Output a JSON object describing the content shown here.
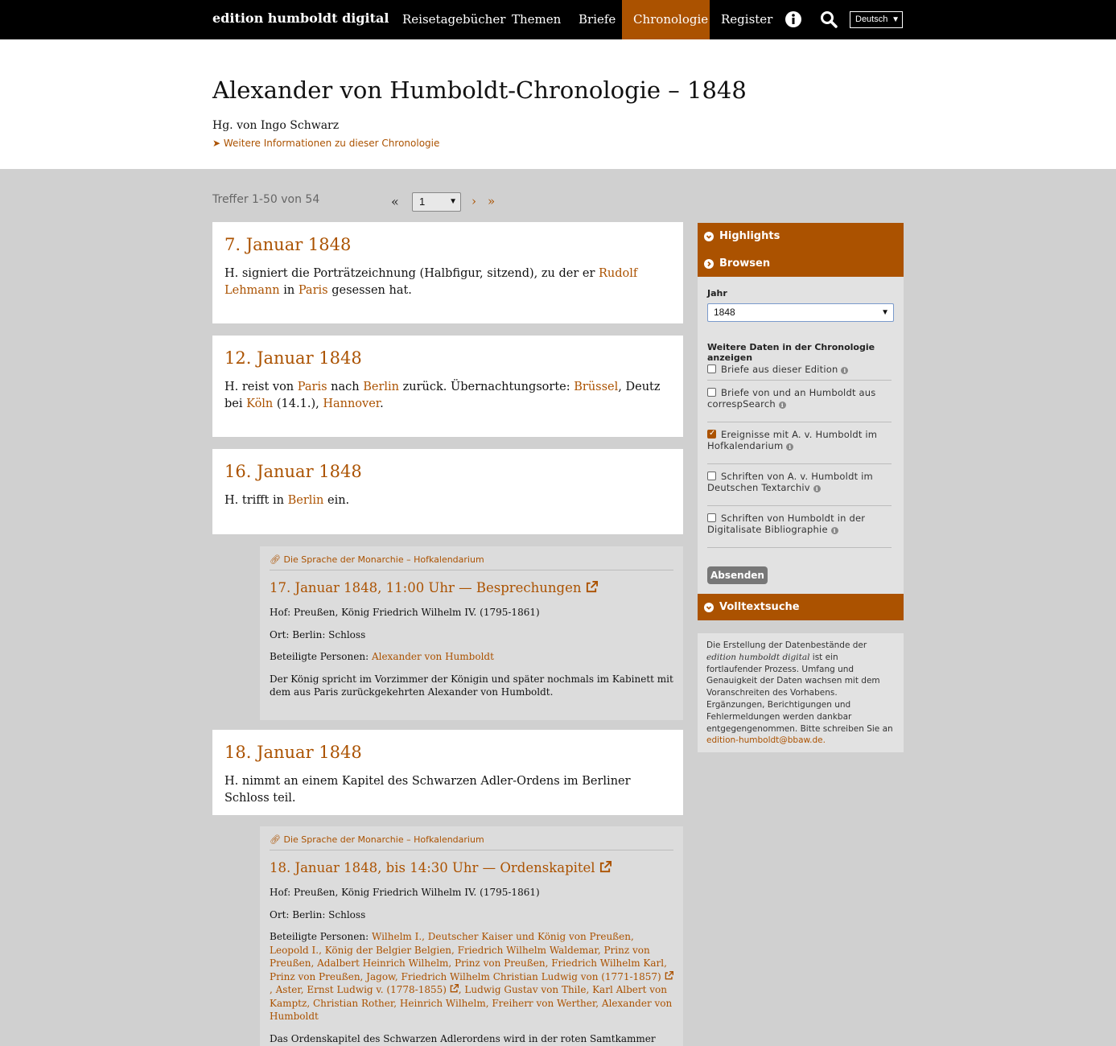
{
  "nav": {
    "brand": "edition humboldt digital",
    "items": [
      "Reisetagebücher",
      "Themen",
      "Briefe",
      "Chronologie",
      "Register"
    ],
    "active": "Chronologie",
    "language": "Deutsch",
    "icons": [
      "info-icon",
      "search-icon"
    ]
  },
  "header": {
    "title": "Alexander von Humboldt-Chronologie – 1848",
    "editor": "Hg. von Ingo Schwarz",
    "more_info": "Weitere Informationen zu dieser Chronologie"
  },
  "pagination": {
    "hits": "Treffer 1-50 von 54",
    "first": "«",
    "page": "1",
    "next": "›",
    "last": "»"
  },
  "entries": [
    {
      "date": "7. Januar 1848",
      "t1": "H. signiert die Porträtzeichnung (Halbfigur, sitzend), zu der er ",
      "l1": "Rudolf Lehmann",
      "t2": " in ",
      "l2": "Paris",
      "t3": " gesessen hat."
    },
    {
      "date": "12. Januar 1848",
      "t1": "H. reist von ",
      "l1": "Paris",
      "t2": " nach ",
      "l2": "Berlin",
      "t3": " zurück. Übernachtungsorte: ",
      "l3": "Brüssel",
      "t4": ", Deutz bei ",
      "l4": "Köln",
      "t5": " (14.1.), ",
      "l5": "Hannover",
      "t6": "."
    },
    {
      "date": "16. Januar 1848",
      "t1": "H. trifft in ",
      "l1": "Berlin",
      "t2": " ein."
    },
    {
      "date": "18. Januar 1848",
      "t1": "H. nimmt an einem Kapitel des Schwarzen Adler-Ordens im Berliner Schloss teil."
    }
  ],
  "subentries": [
    {
      "source": "Die Sprache der Monarchie – Hofkalendarium",
      "title": "17. Januar 1848, 11:00 Uhr — Besprechungen",
      "hof": "Hof: Preußen, König Friedrich Wilhelm IV. (1795-1861)",
      "ort": "Ort: Berlin: Schloss",
      "persons_label": "Beteiligte Personen: ",
      "persons": "Alexander von Humboldt",
      "desc": "Der König spricht im Vorzimmer der Königin und später nochmals im Kabinett mit dem aus Paris zurückgekehrten Alexander von Humboldt."
    },
    {
      "source": "Die Sprache der Monarchie – Hofkalendarium",
      "title": "18. Januar 1848, bis 14:30 Uhr — Ordenskapitel",
      "hof": "Hof: Preußen, König Friedrich Wilhelm IV. (1795-1861)",
      "ort": "Ort: Berlin: Schloss",
      "persons_label": "Beteiligte Personen: ",
      "persons_a": "Wilhelm I., Deutscher Kaiser und König von Preußen, Leopold I., König der Belgier Belgien, Friedrich Wilhelm Waldemar, Prinz von Preußen, Adalbert Heinrich Wilhelm, Prinz von Preußen, Friedrich Wilhelm Karl, Prinz von Preußen, Jagow, Friedrich Wilhelm Christian Ludwig von (1771-1857)",
      "persons_b": ", Aster, Ernst Ludwig v. (1778-1855)",
      "persons_c": ", Ludwig Gustav von Thile, Karl Albert von Kamptz, Christian Rother, Heinrich Wilhelm, Freiherr von Werther, Alexander von Humboldt",
      "desc": "Das Ordenskapitel des Schwarzen Adlerordens wird in der roten Samtkammer abgehalten."
    }
  ],
  "sidebar": {
    "highlights": "Highlights",
    "browse": "Browsen",
    "year_label": "Jahr",
    "year_value": "1848",
    "more_label": "Weitere Daten in der Chronologie anzeigen",
    "options": [
      {
        "label": "Briefe aus dieser Edition",
        "checked": false
      },
      {
        "label": "Briefe von und an Humboldt aus correspSearch",
        "checked": false
      },
      {
        "label": "Ereignisse mit A. v. Humboldt im Hofkalendarium",
        "checked": true
      },
      {
        "label": "Schriften von A. v. Humboldt im Deutschen Textarchiv",
        "checked": false
      },
      {
        "label": "Schriften von Humboldt in der Digitalisate Bibliographie",
        "checked": false
      }
    ],
    "submit": "Absenden",
    "fulltext": "Volltextsuche",
    "notice_a": "Die Erstellung der Datenbestände der ",
    "notice_em": "edition humboldt digital",
    "notice_b": " ist ein fortlaufender Prozess. Umfang und Genauigkeit der Daten wachsen mit dem Voranschreiten des Vorhabens. Ergänzungen, Berichtigungen und Fehlermeldungen werden dankbar entgegengenommen. Bitte schreiben Sie an ",
    "notice_email": "edition-humboldt@bbaw.de."
  },
  "colors": {
    "accent": "#ab5200",
    "nav_bg": "#000000",
    "page_bg": "#d0d0d0"
  }
}
